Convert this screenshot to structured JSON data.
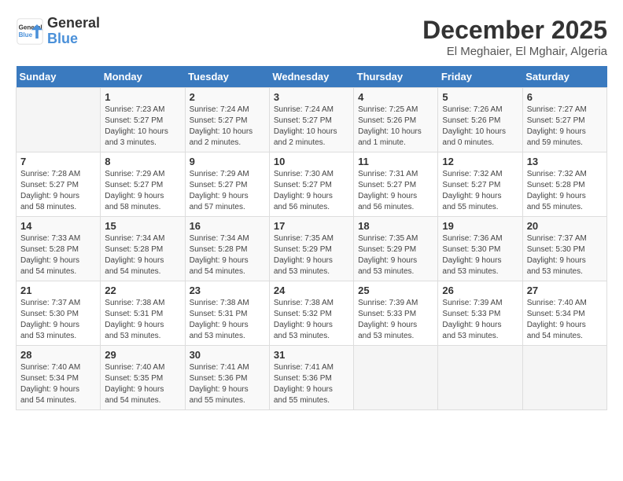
{
  "logo": {
    "line1": "General",
    "line2": "Blue"
  },
  "title": "December 2025",
  "location": "El Meghaier, El Mghair, Algeria",
  "days_header": [
    "Sunday",
    "Monday",
    "Tuesday",
    "Wednesday",
    "Thursday",
    "Friday",
    "Saturday"
  ],
  "weeks": [
    [
      {
        "num": "",
        "info": ""
      },
      {
        "num": "1",
        "info": "Sunrise: 7:23 AM\nSunset: 5:27 PM\nDaylight: 10 hours\nand 3 minutes."
      },
      {
        "num": "2",
        "info": "Sunrise: 7:24 AM\nSunset: 5:27 PM\nDaylight: 10 hours\nand 2 minutes."
      },
      {
        "num": "3",
        "info": "Sunrise: 7:24 AM\nSunset: 5:27 PM\nDaylight: 10 hours\nand 2 minutes."
      },
      {
        "num": "4",
        "info": "Sunrise: 7:25 AM\nSunset: 5:26 PM\nDaylight: 10 hours\nand 1 minute."
      },
      {
        "num": "5",
        "info": "Sunrise: 7:26 AM\nSunset: 5:26 PM\nDaylight: 10 hours\nand 0 minutes."
      },
      {
        "num": "6",
        "info": "Sunrise: 7:27 AM\nSunset: 5:27 PM\nDaylight: 9 hours\nand 59 minutes."
      }
    ],
    [
      {
        "num": "7",
        "info": "Sunrise: 7:28 AM\nSunset: 5:27 PM\nDaylight: 9 hours\nand 58 minutes."
      },
      {
        "num": "8",
        "info": "Sunrise: 7:29 AM\nSunset: 5:27 PM\nDaylight: 9 hours\nand 58 minutes."
      },
      {
        "num": "9",
        "info": "Sunrise: 7:29 AM\nSunset: 5:27 PM\nDaylight: 9 hours\nand 57 minutes."
      },
      {
        "num": "10",
        "info": "Sunrise: 7:30 AM\nSunset: 5:27 PM\nDaylight: 9 hours\nand 56 minutes."
      },
      {
        "num": "11",
        "info": "Sunrise: 7:31 AM\nSunset: 5:27 PM\nDaylight: 9 hours\nand 56 minutes."
      },
      {
        "num": "12",
        "info": "Sunrise: 7:32 AM\nSunset: 5:27 PM\nDaylight: 9 hours\nand 55 minutes."
      },
      {
        "num": "13",
        "info": "Sunrise: 7:32 AM\nSunset: 5:28 PM\nDaylight: 9 hours\nand 55 minutes."
      }
    ],
    [
      {
        "num": "14",
        "info": "Sunrise: 7:33 AM\nSunset: 5:28 PM\nDaylight: 9 hours\nand 54 minutes."
      },
      {
        "num": "15",
        "info": "Sunrise: 7:34 AM\nSunset: 5:28 PM\nDaylight: 9 hours\nand 54 minutes."
      },
      {
        "num": "16",
        "info": "Sunrise: 7:34 AM\nSunset: 5:28 PM\nDaylight: 9 hours\nand 54 minutes."
      },
      {
        "num": "17",
        "info": "Sunrise: 7:35 AM\nSunset: 5:29 PM\nDaylight: 9 hours\nand 53 minutes."
      },
      {
        "num": "18",
        "info": "Sunrise: 7:35 AM\nSunset: 5:29 PM\nDaylight: 9 hours\nand 53 minutes."
      },
      {
        "num": "19",
        "info": "Sunrise: 7:36 AM\nSunset: 5:30 PM\nDaylight: 9 hours\nand 53 minutes."
      },
      {
        "num": "20",
        "info": "Sunrise: 7:37 AM\nSunset: 5:30 PM\nDaylight: 9 hours\nand 53 minutes."
      }
    ],
    [
      {
        "num": "21",
        "info": "Sunrise: 7:37 AM\nSunset: 5:30 PM\nDaylight: 9 hours\nand 53 minutes."
      },
      {
        "num": "22",
        "info": "Sunrise: 7:38 AM\nSunset: 5:31 PM\nDaylight: 9 hours\nand 53 minutes."
      },
      {
        "num": "23",
        "info": "Sunrise: 7:38 AM\nSunset: 5:31 PM\nDaylight: 9 hours\nand 53 minutes."
      },
      {
        "num": "24",
        "info": "Sunrise: 7:38 AM\nSunset: 5:32 PM\nDaylight: 9 hours\nand 53 minutes."
      },
      {
        "num": "25",
        "info": "Sunrise: 7:39 AM\nSunset: 5:33 PM\nDaylight: 9 hours\nand 53 minutes."
      },
      {
        "num": "26",
        "info": "Sunrise: 7:39 AM\nSunset: 5:33 PM\nDaylight: 9 hours\nand 53 minutes."
      },
      {
        "num": "27",
        "info": "Sunrise: 7:40 AM\nSunset: 5:34 PM\nDaylight: 9 hours\nand 54 minutes."
      }
    ],
    [
      {
        "num": "28",
        "info": "Sunrise: 7:40 AM\nSunset: 5:34 PM\nDaylight: 9 hours\nand 54 minutes."
      },
      {
        "num": "29",
        "info": "Sunrise: 7:40 AM\nSunset: 5:35 PM\nDaylight: 9 hours\nand 54 minutes."
      },
      {
        "num": "30",
        "info": "Sunrise: 7:41 AM\nSunset: 5:36 PM\nDaylight: 9 hours\nand 55 minutes."
      },
      {
        "num": "31",
        "info": "Sunrise: 7:41 AM\nSunset: 5:36 PM\nDaylight: 9 hours\nand 55 minutes."
      },
      {
        "num": "",
        "info": ""
      },
      {
        "num": "",
        "info": ""
      },
      {
        "num": "",
        "info": ""
      }
    ]
  ]
}
